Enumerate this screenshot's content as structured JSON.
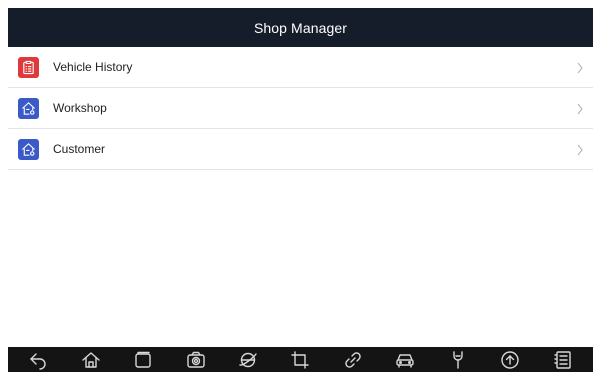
{
  "header": {
    "title": "Shop Manager"
  },
  "menu": {
    "items": [
      {
        "label": "Vehicle History",
        "icon": "clipboard-list-icon",
        "icon_color": "#e0393b"
      },
      {
        "label": "Workshop",
        "icon": "house-settings-icon",
        "icon_color": "#3a5bc7"
      },
      {
        "label": "Customer",
        "icon": "house-settings-icon",
        "icon_color": "#3a5bc7"
      }
    ]
  },
  "navbar": {
    "buttons": [
      "back-icon",
      "home-icon",
      "recent-apps-icon",
      "camera-icon",
      "browser-icon",
      "crop-icon",
      "link-icon",
      "car-icon",
      "wrench-icon",
      "upload-icon",
      "notes-icon"
    ]
  },
  "colors": {
    "topbar_bg": "#161d2a",
    "navbar_bg": "#141414",
    "divider": "#e3e3e3"
  }
}
